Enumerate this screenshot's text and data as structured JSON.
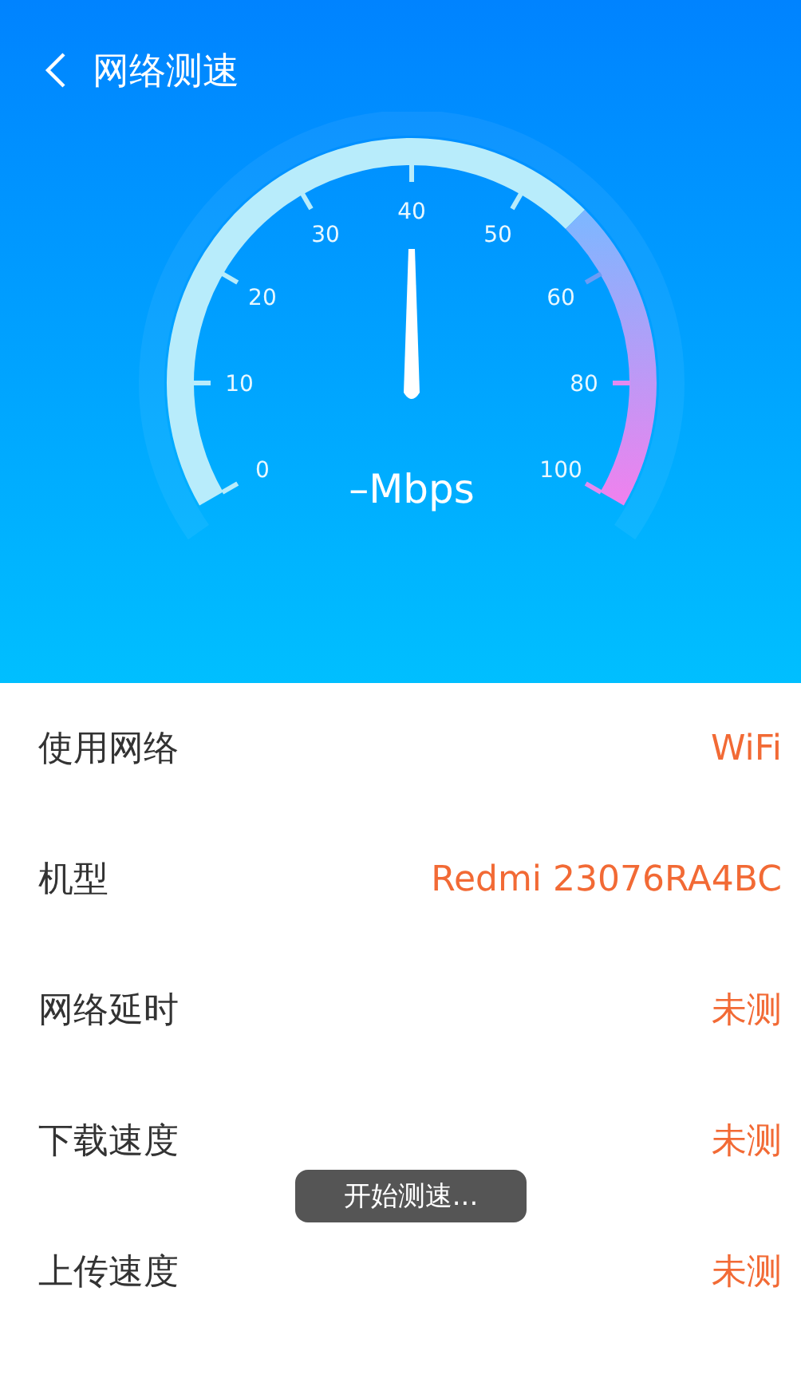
{
  "header": {
    "title": "网络测速"
  },
  "gauge": {
    "labels": [
      "0",
      "10",
      "20",
      "30",
      "40",
      "50",
      "60",
      "80",
      "100"
    ],
    "reading": "–Mbps"
  },
  "info_rows": [
    {
      "label": "使用网络",
      "value": "WiFi"
    },
    {
      "label": "机型",
      "value": "Redmi 23076RA4BC"
    },
    {
      "label": "网络延时",
      "value": "未测"
    },
    {
      "label": "下载速度",
      "value": "未测"
    },
    {
      "label": "上传速度",
      "value": "未测"
    }
  ],
  "toast": {
    "text": "开始测速..."
  }
}
